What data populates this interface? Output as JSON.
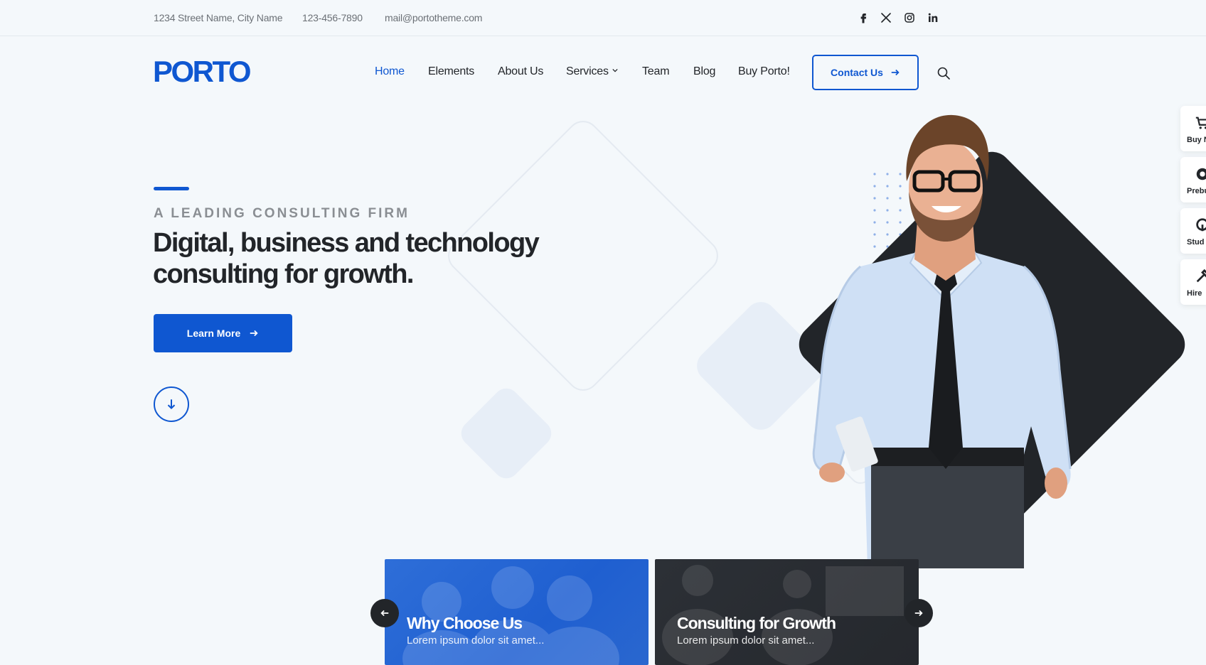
{
  "topbar": {
    "address": "1234 Street Name, City Name",
    "phone": "123-456-7890",
    "email": "mail@portotheme.com",
    "social_icons": [
      "facebook-icon",
      "x-twitter-icon",
      "instagram-icon",
      "linkedin-icon"
    ]
  },
  "header": {
    "logo_text": "PORTO",
    "nav": [
      {
        "label": "Home",
        "active": true
      },
      {
        "label": "Elements"
      },
      {
        "label": "About Us"
      },
      {
        "label": "Services",
        "has_dropdown": true
      },
      {
        "label": "Team"
      },
      {
        "label": "Blog"
      },
      {
        "label": "Buy Porto!"
      }
    ],
    "contact_label": "Contact Us"
  },
  "side_panel": [
    {
      "label": "Buy N",
      "icon": "cart-icon"
    },
    {
      "label": "Prebu",
      "icon": "prebuilt-icon"
    },
    {
      "label": "Stud",
      "icon": "studio-icon"
    },
    {
      "label": "Hire",
      "icon": "tools-icon"
    }
  ],
  "hero": {
    "eyebrow": "A LEADING CONSULTING FIRM",
    "headline_line1": "Digital, business and technology",
    "headline_line2": "consulting for growth.",
    "cta_label": "Learn More"
  },
  "cards": [
    {
      "title": "Why Choose Us",
      "text": "Lorem ipsum dolor sit amet..."
    },
    {
      "title": "Consulting for Growth",
      "text": "Lorem ipsum dolor sit amet..."
    }
  ],
  "colors": {
    "primary": "#0f57d1",
    "dark": "#222529",
    "background": "#f4f8fb"
  }
}
